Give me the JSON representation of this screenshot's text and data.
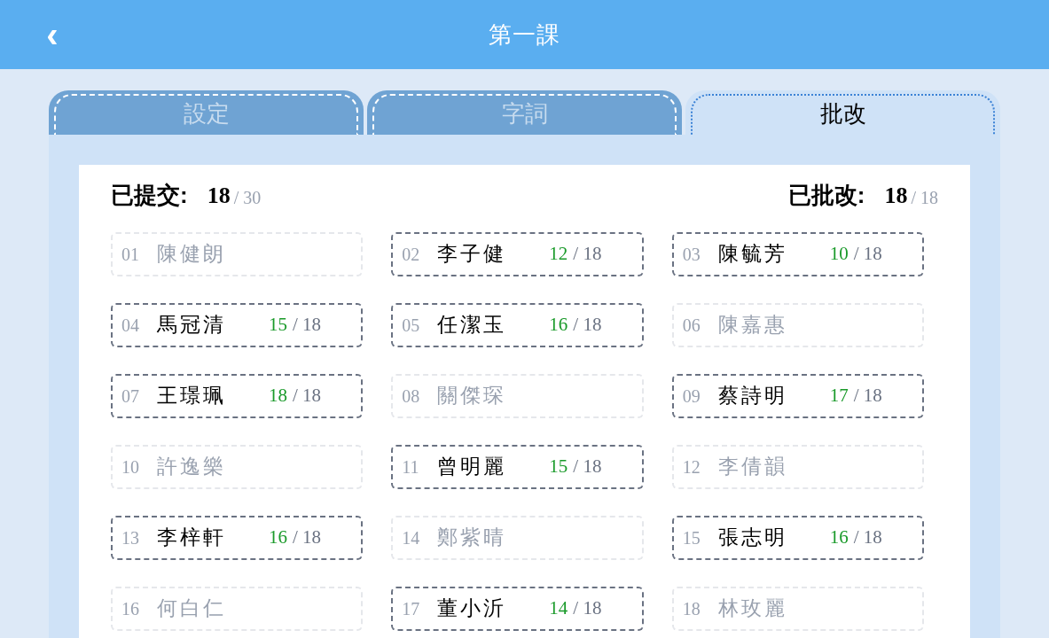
{
  "header": {
    "back_icon": "‹",
    "title": "第一課"
  },
  "tabs": [
    {
      "label": "設定",
      "selected": false
    },
    {
      "label": "字詞",
      "selected": false
    },
    {
      "label": "批改",
      "selected": true
    }
  ],
  "summary": {
    "submitted_label": "已提交:",
    "submitted": "18",
    "submitted_total": "/ 30",
    "graded_label": "已批改:",
    "graded": "18",
    "graded_total": "/ 18"
  },
  "students": [
    {
      "number": "01",
      "name": "陳健朗",
      "submitted": false
    },
    {
      "number": "02",
      "name": "李子健",
      "submitted": true,
      "score": "12",
      "out_of": "/ 18"
    },
    {
      "number": "03",
      "name": "陳毓芳",
      "submitted": true,
      "score": "10",
      "out_of": "/ 18"
    },
    {
      "number": "04",
      "name": "馬冠清",
      "submitted": true,
      "score": "15",
      "out_of": "/ 18"
    },
    {
      "number": "05",
      "name": "任潔玉",
      "submitted": true,
      "score": "16",
      "out_of": "/ 18"
    },
    {
      "number": "06",
      "name": "陳嘉惠",
      "submitted": false
    },
    {
      "number": "07",
      "name": "王璟珮",
      "submitted": true,
      "score": "18",
      "out_of": "/ 18"
    },
    {
      "number": "08",
      "name": "關傑琛",
      "submitted": false
    },
    {
      "number": "09",
      "name": "蔡詩明",
      "submitted": true,
      "score": "17",
      "out_of": "/ 18"
    },
    {
      "number": "10",
      "name": "許逸樂",
      "submitted": false
    },
    {
      "number": "11",
      "name": "曾明麗",
      "submitted": true,
      "score": "15",
      "out_of": "/ 18"
    },
    {
      "number": "12",
      "name": "李倩韻",
      "submitted": false
    },
    {
      "number": "13",
      "name": "李梓軒",
      "submitted": true,
      "score": "16",
      "out_of": "/ 18"
    },
    {
      "number": "14",
      "name": "鄭紫晴",
      "submitted": false
    },
    {
      "number": "15",
      "name": "張志明",
      "submitted": true,
      "score": "16",
      "out_of": "/ 18"
    },
    {
      "number": "16",
      "name": "何白仁",
      "submitted": false
    },
    {
      "number": "17",
      "name": "董小沂",
      "submitted": true,
      "score": "14",
      "out_of": "/ 18"
    },
    {
      "number": "18",
      "name": "林玫麗",
      "submitted": false
    }
  ]
}
